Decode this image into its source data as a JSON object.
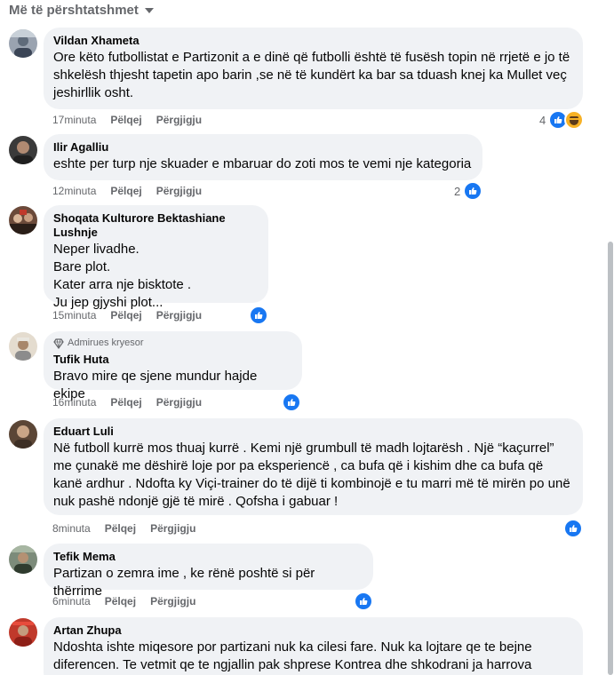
{
  "sort_label": "Më të përshtatshmet",
  "actions": {
    "like": "Pëlqej",
    "reply": "Përgjigju"
  },
  "comments": [
    {
      "author": "Vildan Xhameta",
      "text": "Ore këto futbollistat e Partizonit a e dinë që futbolli është të fusësh topin në rrjetë e jo të shkelësh thjesht tapetin apo barin ,se në të kundërt ka bar sa tduash knej ka Mullet veç jeshirllik osht.",
      "time": "17minuta",
      "reaction_count": "4",
      "reactions": [
        "like-icon",
        "haha-icon"
      ]
    },
    {
      "author": "Ilir Agalliu",
      "text": "eshte per turp nje skuader e mbaruar do zoti mos te vemi nje kategoria",
      "time": "12minuta",
      "reaction_count": "2",
      "reactions": [
        "like-icon"
      ]
    },
    {
      "author": "Shoqata Kulturore Bektashiane Lushnje",
      "text": "Neper livadhe.\nBare plot.\nKater arra nje bisktote .\nJu jep gjyshi plot...",
      "time": "15minuta",
      "reaction_count": "",
      "reactions": [
        "like-icon"
      ]
    },
    {
      "badge": "Admirues kryesor",
      "author": "Tufik Huta",
      "text": "Bravo mire qe sjene mundur hajde ekipe",
      "time": "16minuta",
      "reaction_count": "",
      "reactions": [
        "like-icon"
      ]
    },
    {
      "author": "Eduart Luli",
      "text": "Në futboll kurrë mos thuaj kurrë . Kemi një grumbull të madh lojtarësh . Një “kaçurrel” me çunakë me dëshirë loje por pa eksperiencë , ca bufa që i kishim dhe ca bufa që kanë ardhur . Ndofta ky Viçi-trainer do të dijë ti kombinojë e tu marri më të mirën po unë nuk pashë ndonjë gjë të mirë . Qofsha i gabuar !",
      "time": "8minuta",
      "reaction_count": "",
      "reactions": [
        "like-icon"
      ]
    },
    {
      "author": "Tefik Mema",
      "text": "Partizan o zemra ime , ke rënë poshtë si për thërrime",
      "time": "6minuta",
      "reaction_count": "",
      "reactions": [
        "like-icon"
      ]
    },
    {
      "author": "Artan Zhupa",
      "text": "Ndoshta ishte miqesore por partizani nuk ka cilesi fare. Nuk ka lojtare qe te bejne diferencen. Te vetmit qe te ngjallin pak shprese Kontrea dhe shkodrani ja harrova",
      "time": "",
      "reaction_count": "",
      "reactions": []
    }
  ]
}
